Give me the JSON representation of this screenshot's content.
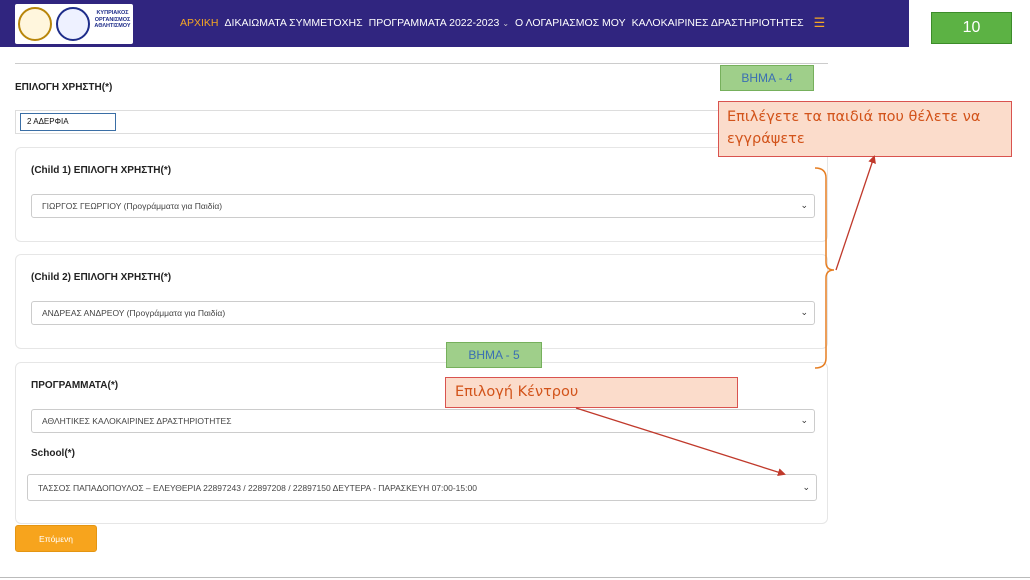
{
  "header": {
    "logo_text": "ΚΥΠΡΙΑΚΟΣ ΟΡΓΑΝΙΣΜΟΣ ΑΘΛΗΤΙΣΜΟΥ",
    "nav": [
      {
        "label": "ΑΡΧΙΚΗ",
        "active": true
      },
      {
        "label": "ΔΙΚΑΙΩΜΑΤΑ ΣΥΜΜΕΤΟΧΗΣ"
      },
      {
        "label": "ΠΡΟΓΡΑΜΜΑΤΑ 2022-2023"
      },
      {
        "label": "Ο ΛΟΓΑΡΙΑΣΜΟΣ ΜΟΥ"
      },
      {
        "label": "ΚΑΛΟΚΑΙΡΙΝΕΣ ΔΡΑΣΤΗΡΙΟΤΗΤΕΣ"
      }
    ],
    "page_number": "10"
  },
  "form": {
    "user_select_label": "ΕΠΙΛΟΓΗ ΧΡΗΣΤΗ",
    "required_mark": "(*)",
    "user_select_value": "2 ΑΔΕΡΦΙΑ",
    "child1_label": "(Child 1) ΕΠΙΛΟΓΗ ΧΡΗΣΤΗ",
    "child1_value": "ΓΙΩΡΓΟΣ ΓΕΩΡΓΙΟΥ (Προγράμματα για Παιδία)",
    "child2_label": "(Child 2) ΕΠΙΛΟΓΗ ΧΡΗΣΤΗ",
    "child2_value": "ΑΝΔΡΕΑΣ ΑΝΔΡΕΟΥ (Προγράμματα για Παιδία)",
    "programs_label": "ΠΡΟΓΡΑΜΜΑΤΑ",
    "programs_value": "ΑΘΛΗΤΙΚΕΣ ΚΑΛΟΚΑΙΡΙΝΕΣ ΔΡΑΣΤΗΡΙΟΤΗΤΕΣ",
    "school_label": "School",
    "school_value": "ΤΑΣΣΟΣ ΠΑΠΑΔΟΠΟΥΛΟΣ – ΕΛΕΥΘΕΡΙΑ 22897243 / 22897208 / 22897150 ΔΕΥΤΕΡΑ - ΠΑΡΑΣΚΕΥΗ 07:00-15:00",
    "next_button": "Επόμενη"
  },
  "annotations": {
    "step4": "ΒΗΜΑ - 4",
    "step4_note": "Επιλέγετε τα παιδιά που θέλετε να εγγράψετε",
    "step5": "ΒΗΜΑ - 5",
    "step5_note": "Επιλογή Κέντρου",
    "annotation_color": "#d9534f",
    "step_color": "#9fcf8a"
  },
  "colors": {
    "nav_bg": "#30257f",
    "nav_active": "#f5a623",
    "button_bg": "#f7a41d",
    "page_badge_bg": "#5cb244"
  }
}
